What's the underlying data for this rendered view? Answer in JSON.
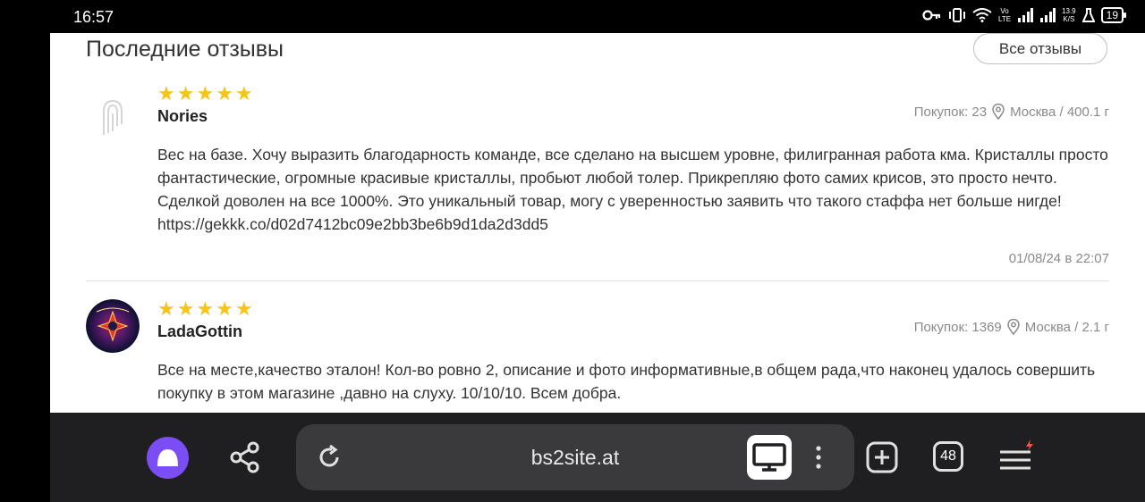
{
  "status_bar": {
    "time": "16:57",
    "network_top": "Vo",
    "network_bottom": "LTE",
    "speed_top": "13.9",
    "speed_bottom": "K/S",
    "battery": "19"
  },
  "section": {
    "title": "Последние отзывы",
    "all_reviews_label": "Все отзывы"
  },
  "reviews": [
    {
      "author": "Nories",
      "rating": 5,
      "purchases": "Покупок: 23",
      "location": "Москва / 400.1 г",
      "text": "Вес на базе. Хочу выразить благодарность команде, все сделано на высшем уровне, филигранная работа кма. Кристаллы просто фантастические, огромные красивые кристаллы, пробьют любой толер. Прикрепляю фото самих крисов, это просто нечто. Сделкой доволен на все 1000%. Это уникальный товар, могу с уверенностью заявить что такого стаффа нет больше нигде! https://gekkk.co/d02d7412bc09e2bb3be6b9d1da2d3dd5",
      "date": "01/08/24 в 22:07"
    },
    {
      "author": "LadaGottin",
      "rating": 5,
      "purchases": "Покупок: 1369",
      "location": "Москва / 2.1 г",
      "text": "Все на месте,качество эталон! Кол-во ровно 2, описание и фото информативные,в общем рада,что наконец удалось совершить покупку в этом магазине ,давно на слуху. 10/10/10. Всем добра."
    }
  ],
  "browser": {
    "url": "bs2site.at",
    "tab_count": "48"
  },
  "colors": {
    "star": "#f5c518",
    "alice": "#7a4df5",
    "bar": "#1f1f21"
  }
}
